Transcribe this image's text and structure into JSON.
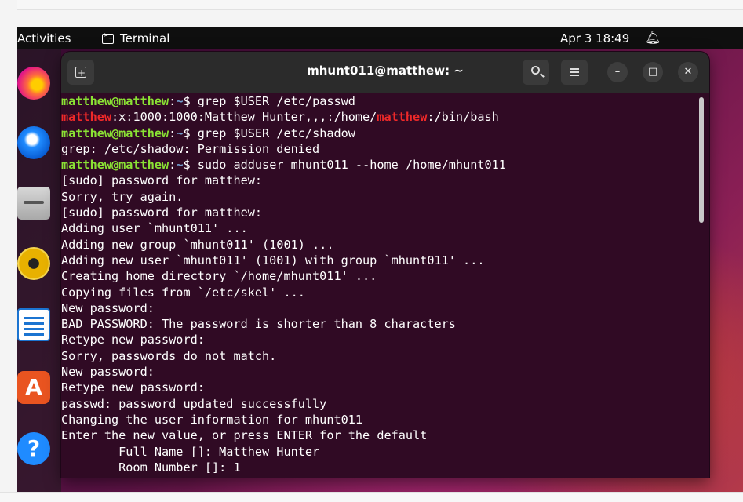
{
  "topbar": {
    "activities": "Activities",
    "app_name": "Terminal",
    "clock": "Apr 3  18:49"
  },
  "dock": {
    "items": [
      "firefox-icon",
      "thunderbird-icon",
      "files-icon",
      "rhythmbox-icon",
      "libreoffice-writer-icon",
      "app-center-icon",
      "help-icon"
    ]
  },
  "window": {
    "title": "mhunt011@matthew: ~"
  },
  "colors": {
    "prompt_user": "#8ae234",
    "prompt_path": "#729fcf",
    "grep_match": "#ef2929",
    "terminal_bg": "#300a24"
  },
  "terminal": {
    "lines": [
      {
        "prompt": {
          "user": "matthew@matthew",
          "path": "~",
          "sym": "$ "
        },
        "text": "grep $USER /etc/passwd"
      },
      {
        "segments": [
          {
            "t": "matthew",
            "hl": true
          },
          {
            "t": ":x:1000:1000:Matthew Hunter,,,:/home/"
          },
          {
            "t": "matthew",
            "hl": true
          },
          {
            "t": ":/bin/bash"
          }
        ]
      },
      {
        "prompt": {
          "user": "matthew@matthew",
          "path": "~",
          "sym": "$ "
        },
        "text": "grep $USER /etc/shadow"
      },
      {
        "text": "grep: /etc/shadow: Permission denied"
      },
      {
        "prompt": {
          "user": "matthew@matthew",
          "path": "~",
          "sym": "$ "
        },
        "text": "sudo adduser mhunt011 --home /home/mhunt011"
      },
      {
        "text": "[sudo] password for matthew:"
      },
      {
        "text": "Sorry, try again."
      },
      {
        "text": "[sudo] password for matthew:"
      },
      {
        "text": "Adding user `mhunt011' ..."
      },
      {
        "text": "Adding new group `mhunt011' (1001) ..."
      },
      {
        "text": "Adding new user `mhunt011' (1001) with group `mhunt011' ..."
      },
      {
        "text": "Creating home directory `/home/mhunt011' ..."
      },
      {
        "text": "Copying files from `/etc/skel' ..."
      },
      {
        "text": "New password:"
      },
      {
        "text": "BAD PASSWORD: The password is shorter than 8 characters"
      },
      {
        "text": "Retype new password:"
      },
      {
        "text": "Sorry, passwords do not match."
      },
      {
        "text": "New password:"
      },
      {
        "text": "Retype new password:"
      },
      {
        "text": "passwd: password updated successfully"
      },
      {
        "text": "Changing the user information for mhunt011"
      },
      {
        "text": "Enter the new value, or press ENTER for the default"
      },
      {
        "text": "\tFull Name []: Matthew Hunter"
      },
      {
        "text": "\tRoom Number []: 1"
      }
    ]
  }
}
